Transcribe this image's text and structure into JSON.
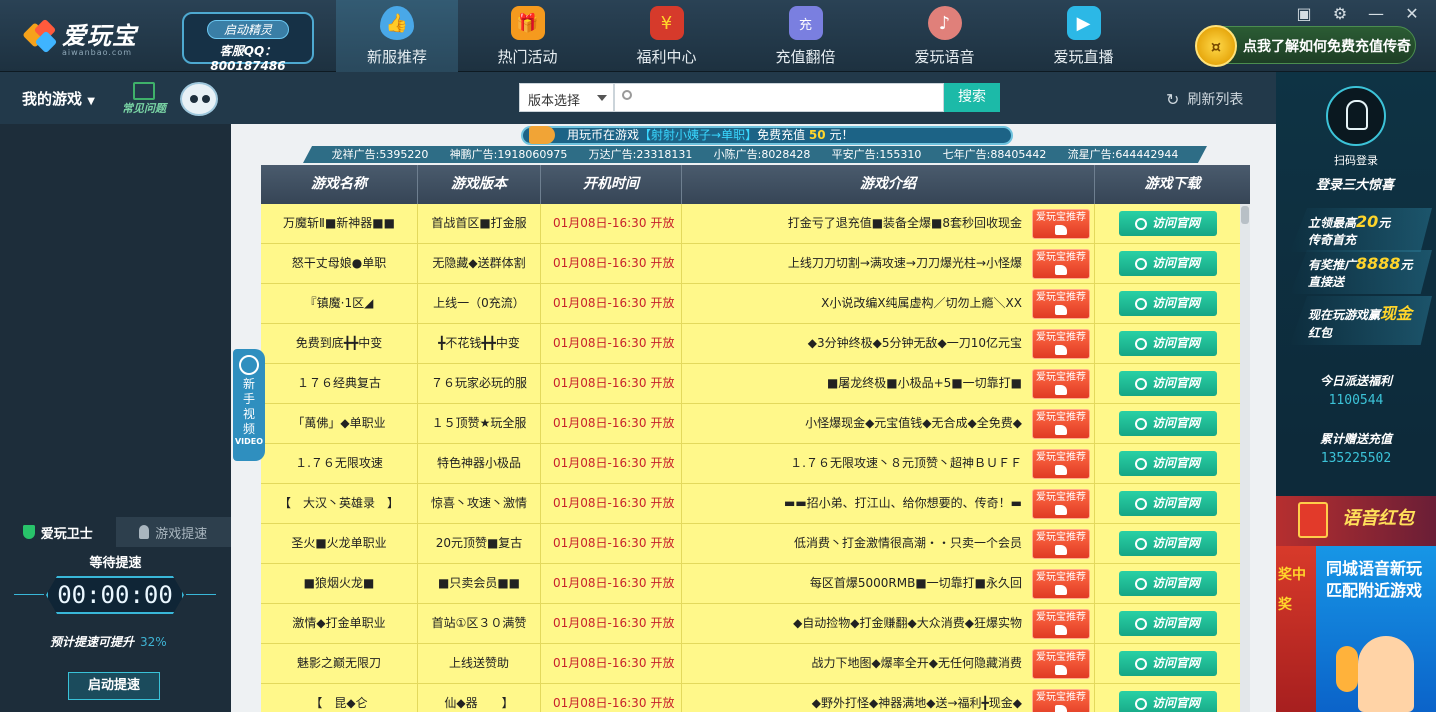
{
  "app": {
    "logo_text": "爱玩宝",
    "logo_sub": "aiwanbao.com",
    "sprite_label": "启动精灵",
    "service_qq": "客服QQ：800187486",
    "nav": [
      {
        "label": "新服推荐",
        "icon": "water-drop-icon",
        "active": true
      },
      {
        "label": "热门活动",
        "icon": "gift-box-icon",
        "active": false
      },
      {
        "label": "福利中心",
        "icon": "red-envelope-icon",
        "active": false
      },
      {
        "label": "充值翻倍",
        "icon": "coins-icon",
        "active": false
      },
      {
        "label": "爱玩语音",
        "icon": "voice-person-icon",
        "active": false
      },
      {
        "label": "爱玩直播",
        "icon": "tv-icon",
        "active": false
      }
    ],
    "promo_text": "点我了解如何免费充值传奇"
  },
  "subbar": {
    "my_games": "我的游戏",
    "faq": "常见问题",
    "version_select": "版本选择",
    "search_value": "",
    "search_button": "搜索",
    "refresh": "刷新列表"
  },
  "left": {
    "tab_guard": "爱玩卫士",
    "tab_boost": "游戏提速",
    "waiting": "等待提速",
    "timer": "00:00:00",
    "boost_note": "预计提速可提升",
    "boost_percent": "32%",
    "boost_button": "启动提速"
  },
  "video_tab": {
    "text": "新手视频",
    "video": "VIDEO"
  },
  "announce": {
    "pre": "用玩币在游戏",
    "highlight": "【射射小姨子→单职】",
    "mid": "免费充值",
    "amount": "50",
    "post": "元！"
  },
  "ads": [
    "龙祥广告:5395220",
    "神鹏广告:1918060975",
    "万达广告:23318131",
    "小陈广告:8028428",
    "平安广告:155310",
    "七年广告:88405442",
    "流星广告:644442944"
  ],
  "table": {
    "headers": [
      "游戏名称",
      "游戏版本",
      "开机时间",
      "游戏介绍",
      "游戏下载"
    ],
    "badge": "爱玩宝推荐",
    "visit": "访问官网",
    "rows": [
      {
        "name": "万魔斩Ⅱ■新神器■■",
        "version": "首战首区■打金服",
        "time": "01月08日-16:30",
        "status": "开放",
        "intro": "打金亏了退充值■装备全爆■8套秒回收现金"
      },
      {
        "name": "怒干丈母娘●单职",
        "version": "无隐藏◆送群体割",
        "time": "01月08日-16:30",
        "status": "开放",
        "intro": "上线刀刀切割→满攻速→刀刀爆光柱→小怪爆"
      },
      {
        "name": "『镇魔·1区◢",
        "version": "上线一（0充流）",
        "time": "01月08日-16:30",
        "status": "开放",
        "intro": "Ⅹ小说改编Ⅹ纯属虚构／切勿上瘾＼ⅩⅩ"
      },
      {
        "name": "免费到底╋╋中变",
        "version": "╋不花钱╋╋中变",
        "time": "01月08日-16:30",
        "status": "开放",
        "intro": "◆3分钟终极◆5分钟无敌◆一刀10亿元宝"
      },
      {
        "name": "１７６经典复古",
        "version": "７６玩家必玩的服",
        "time": "01月08日-16:30",
        "status": "开放",
        "intro": "■屠龙终极■小极品+5■一切靠打■"
      },
      {
        "name": "「萬佛」◆单职业",
        "version": "１５顶赞★玩全服",
        "time": "01月08日-16:30",
        "status": "开放",
        "intro": "小怪爆现金◆元宝值钱◆无合成◆全免费◆"
      },
      {
        "name": "１.７６无限攻速",
        "version": "特色神器小极品",
        "time": "01月08日-16:30",
        "status": "开放",
        "intro": "１.７６无限攻速丶８元顶赞丶超神ＢＵＦＦ"
      },
      {
        "name": "【　大汉丶英雄录　】",
        "version": "惊喜丶攻速丶激情",
        "time": "01月08日-16:30",
        "status": "开放",
        "intro": "▬▬招小弟、打江山、给你想要的、传奇！▬"
      },
      {
        "name": "圣火■火龙单职业",
        "version": "20元顶赞■复古",
        "time": "01月08日-16:30",
        "status": "开放",
        "intro": "低消费丶打金激情很高潮・・只卖一个会员"
      },
      {
        "name": "■狼烟火龙■",
        "version": "■只卖会员■■",
        "time": "01月08日-16:30",
        "status": "开放",
        "intro": "每区首爆5000RMB■一切靠打■永久回"
      },
      {
        "name": "激情◆打金单职业",
        "version": "首站①区３０满赞",
        "time": "01月08日-16:30",
        "status": "开放",
        "intro": "◆自动捡物◆打金赚翻◆大众消费◆狂爆实物"
      },
      {
        "name": "魅影之巅无限刀",
        "version": "上线送赞助",
        "time": "01月08日-16:30",
        "status": "开放",
        "intro": "战力下地图◆爆率全开◆无任何隐藏消费"
      },
      {
        "name": "【　昆◆仑",
        "version": "仙◆器　　】",
        "time": "01月08日-16:30",
        "status": "开放",
        "intro": "◆野外打怪◆神器满地◆送→福利╋现金◆"
      }
    ]
  },
  "right": {
    "scan": "扫码登录",
    "surprise": "登录三大惊喜",
    "gift1_pre": "立领最高",
    "gift1_amount": "20",
    "gift1_unit": "元",
    "gift1_post": "传奇首充",
    "gift2_pre": "有奖推广",
    "gift2_amount": "8888",
    "gift2_unit": "元",
    "gift2_post": "直接送",
    "gift3_pre": "现在玩游戏赢",
    "gift3_hl": "现金",
    "gift3_post": "红包",
    "today_label": "今日派送福利",
    "today_value": "1100544",
    "total_label": "累计赠送充值",
    "total_value": "135225502",
    "voice_red": "语音红包",
    "city_side": "奖中奖",
    "city_title1": "同城语音新玩",
    "city_title2": "匹配附近游戏"
  },
  "colors": {
    "accent": "#1cbaa8",
    "row_bg": "#fff88a",
    "time_red": "#c8202b",
    "badge_red": "#e03a23"
  }
}
